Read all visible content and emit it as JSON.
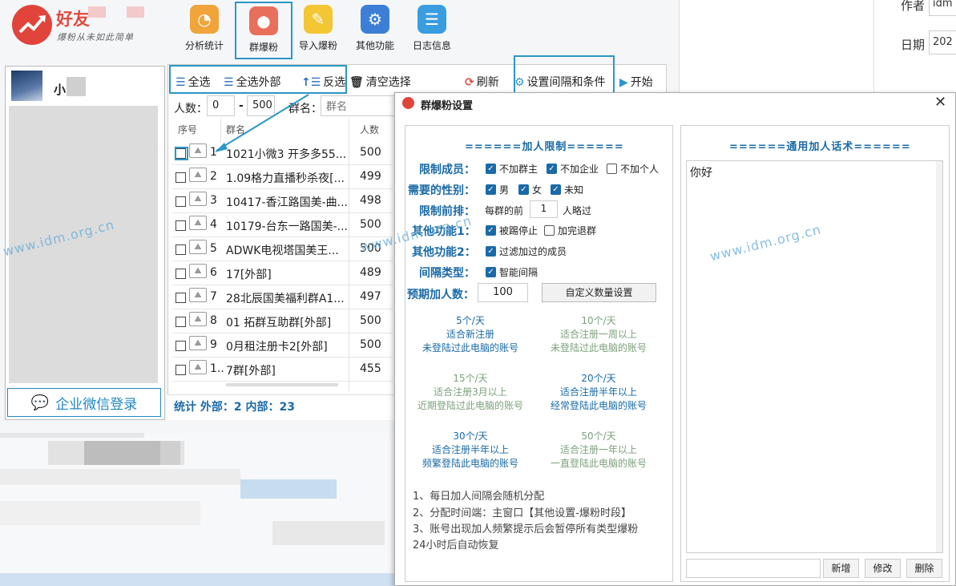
{
  "background": {
    "author_label": "作者",
    "author_value": "idm",
    "date_label": "日期",
    "date_value": "202"
  },
  "app": {
    "logo_text": "好友",
    "slogan": "爆粉从未如此简单"
  },
  "toolbar": [
    {
      "label": "分析统计",
      "icon": "chart-icon",
      "color": "#f0a43a"
    },
    {
      "label": "群爆粉",
      "icon": "user-icon",
      "color": "#e86f5b"
    },
    {
      "label": "导入爆粉",
      "icon": "pen-icon",
      "color": "#f3c633"
    },
    {
      "label": "其他功能",
      "icon": "gear-icon",
      "color": "#3d7fd6"
    },
    {
      "label": "日志信息",
      "icon": "clipboard-icon",
      "color": "#3a9de0"
    }
  ],
  "account": {
    "name": "小",
    "login_label": "企业微信登录"
  },
  "actions": {
    "select_all": "全选",
    "select_external": "全选外部",
    "invert": "反选",
    "clear": "清空选择",
    "refresh": "刷新",
    "interval": "设置间隔和条件",
    "start": "开始"
  },
  "filter": {
    "count_label": "人数：",
    "min": "0",
    "dash": "-",
    "max": "500",
    "name_label": "群名：",
    "name_placeholder": "群名"
  },
  "table": {
    "headers": [
      "序号",
      "群名",
      "人数"
    ],
    "rows": [
      {
        "idx": "1",
        "name": "1021小微3 开多多55...",
        "count": "500"
      },
      {
        "idx": "2",
        "name": "1.09格力直播秒杀夜[...",
        "count": "499"
      },
      {
        "idx": "3",
        "name": "10417-香江路国美-曲...",
        "count": "498"
      },
      {
        "idx": "4",
        "name": "10179-台东一路国美-...",
        "count": "500"
      },
      {
        "idx": "5",
        "name": " ADWK电视塔国美王...",
        "count": "500"
      },
      {
        "idx": "6",
        "name": "17[外部]",
        "count": "489"
      },
      {
        "idx": "7",
        "name": "28北辰国美福利群A1...",
        "count": "497"
      },
      {
        "idx": "8",
        "name": "01 拓群互助群[外部]",
        "count": "500"
      },
      {
        "idx": "9",
        "name": "0月租注册卡2[外部]",
        "count": "500"
      },
      {
        "idx": "1..",
        "name": "7群[外部]",
        "count": "455"
      }
    ]
  },
  "stats": "统计 外部：2 内部：23",
  "dialog": {
    "title": "群爆粉设置",
    "limits_header": "======加人限制======",
    "template_header": "======通用加人话术======",
    "fields": {
      "member_limit": "限制成员：",
      "gender": "需要的性别：",
      "skip_front": "限制前排：",
      "other1": "其他功能1：",
      "other2": "其他功能2：",
      "interval_type": "间隔类型：",
      "expected": "预期加人数："
    },
    "checks": {
      "no_owner": "不加群主",
      "no_enterprise": "不加企业",
      "no_personal": "不加个人",
      "male": "男",
      "female": "女",
      "unknown": "未知",
      "skip_prefix": "每群的前",
      "skip_value": "1",
      "skip_suffix": "人略过",
      "stop_on_kick": "被踢停止",
      "quit_after": "加完退群",
      "filter_added": "过滤加过的成员",
      "smart_interval": "智能间隔"
    },
    "expected_value": "100",
    "custom_btn": "自定义数量设置",
    "rates": [
      {
        "a": "5个/天",
        "b": "适合新注册",
        "c": "未登陆过此电脑的账号",
        "on": true
      },
      {
        "a": "10个/天",
        "b": "适合注册一周以上",
        "c": "未登陆过此电脑的账号",
        "on": false
      },
      {
        "a": "15个/天",
        "b": "适合注册3月以上",
        "c": "近期登陆过此电脑的账号",
        "on": false
      },
      {
        "a": "20个/天",
        "b": "适合注册半年以上",
        "c": "经常登陆此电脑的账号",
        "on": true
      },
      {
        "a": "30个/天",
        "b": "适合注册半年以上",
        "c": "频繁登陆此电脑的账号",
        "on": true
      },
      {
        "a": "50个/天",
        "b": "适合注册一年以上",
        "c": "一直登陆此电脑的账号",
        "on": false
      }
    ],
    "notes": [
      "1、每日加人间隔会随机分配",
      "2、分配时间端：主窗口【其他设置-爆粉时段】",
      "3、账号出现加人频繁提示后会暂停所有类型爆粉",
      "24小时后自动恢复"
    ],
    "template_text": "你好",
    "btn_add": "新增",
    "btn_edit": "修改",
    "btn_delete": "删除"
  },
  "watermark": "www.idm.org.cn"
}
